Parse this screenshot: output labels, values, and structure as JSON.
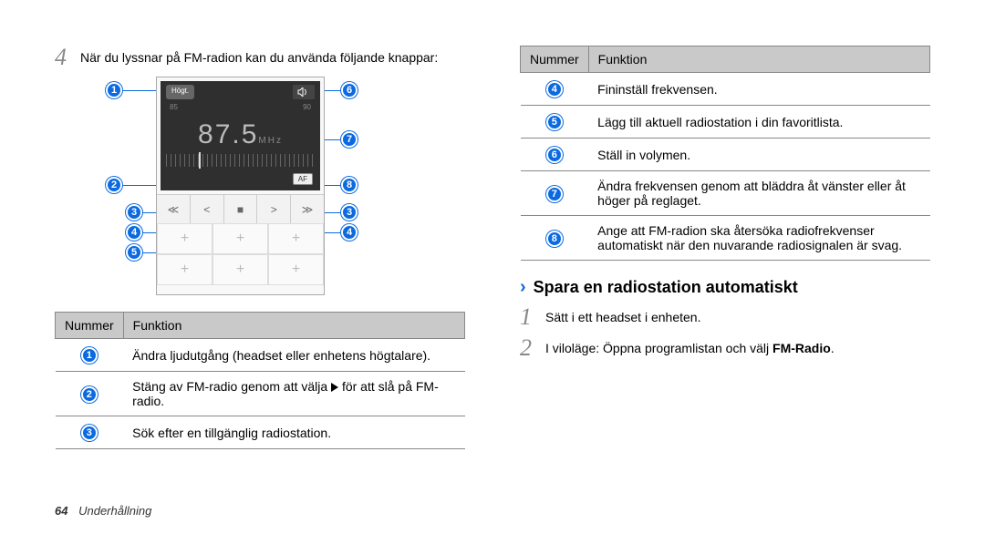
{
  "left": {
    "step4_num": "4",
    "step4_text": "När du lyssnar på FM-radion kan du använda följande knappar:",
    "radio": {
      "badge": "Högt.",
      "scale_left": "85",
      "scale_right": "90",
      "freq": "87.5",
      "freq_unit": "MHz",
      "af": "AF",
      "controls": [
        "≪",
        "<",
        "■",
        ">",
        "≫"
      ],
      "preset_plus": "+"
    },
    "callouts": {
      "c1": "1",
      "c2": "2",
      "c3l": "3",
      "c3r": "3",
      "c4l": "4",
      "c4r": "4",
      "c5": "5",
      "c6": "6",
      "c7": "7",
      "c8": "8"
    },
    "table": {
      "head_num": "Nummer",
      "head_func": "Funktion",
      "rows": [
        {
          "n": "1",
          "text": "Ändra ljudutgång (headset eller enhetens högtalare)."
        },
        {
          "n": "2",
          "text_before": "Stäng av FM-radio genom att välja ",
          "text_after": " för att slå på FM-radio.",
          "has_play": true
        },
        {
          "n": "3",
          "text": "Sök efter en tillgänglig radiostation."
        }
      ]
    }
  },
  "right": {
    "table": {
      "head_num": "Nummer",
      "head_func": "Funktion",
      "rows": [
        {
          "n": "4",
          "text": "Fininställ frekvensen."
        },
        {
          "n": "5",
          "text": "Lägg till aktuell radiostation i din favoritlista."
        },
        {
          "n": "6",
          "text": "Ställ in volymen."
        },
        {
          "n": "7",
          "text": "Ändra frekvensen genom att bläddra åt vänster eller åt höger på reglaget."
        },
        {
          "n": "8",
          "text": "Ange att FM-radion ska återsöka radiofrekvenser automatiskt när den nuvarande radiosignalen är svag."
        }
      ]
    },
    "heading": "Spara en radiostation automatiskt",
    "step1_num": "1",
    "step1_text": "Sätt i ett headset i enheten.",
    "step2_num": "2",
    "step2_text_before": "I viloläge: Öppna programlistan och välj ",
    "step2_bold": "FM-Radio",
    "step2_text_after": "."
  },
  "footer": {
    "page": "64",
    "section": "Underhållning"
  }
}
